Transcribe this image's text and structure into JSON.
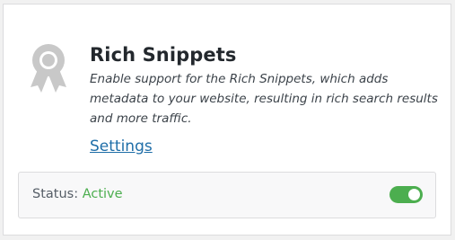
{
  "module": {
    "title": "Rich Snippets",
    "description": "Enable support for the Rich Snippets, which adds metadata to your website, resulting in rich search results and more traffic.",
    "settings_link": "Settings",
    "icon": "award-ribbon-icon",
    "status_label": "Status:",
    "status_value": "Active",
    "enabled": true
  },
  "colors": {
    "active": "#4cae4f",
    "link": "#1f6ea8",
    "icon": "#c8c8c8"
  }
}
